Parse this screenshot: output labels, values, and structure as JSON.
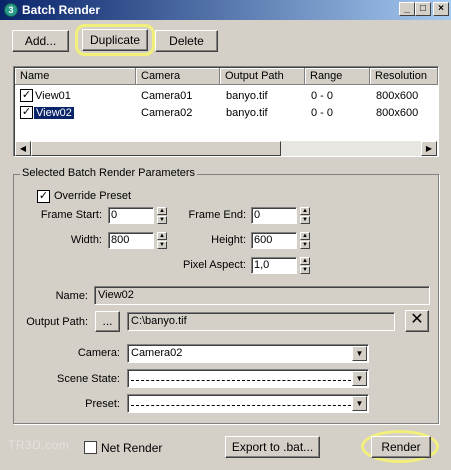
{
  "window": {
    "title": "Batch Render",
    "app_icon_glyph": "3"
  },
  "toolbar": {
    "add_label": "Add...",
    "duplicate_label": "Duplicate",
    "delete_label": "Delete"
  },
  "list": {
    "columns": [
      "Name",
      "Camera",
      "Output Path",
      "Range",
      "Resolution"
    ],
    "rows": [
      {
        "name": "View01",
        "camera": "Camera01",
        "output": "banyo.tif",
        "range": "0 - 0",
        "resolution": "800x600",
        "checked": true,
        "selected": false
      },
      {
        "name": "View02",
        "camera": "Camera02",
        "output": "banyo.tif",
        "range": "0 - 0",
        "resolution": "800x600",
        "checked": true,
        "selected": true
      }
    ]
  },
  "params": {
    "group_title": "Selected Batch Render Parameters",
    "override_label": "Override Preset",
    "override_checked": true,
    "frame_start_label": "Frame Start:",
    "frame_start": "0",
    "frame_end_label": "Frame End:",
    "frame_end": "0",
    "width_label": "Width:",
    "width": "800",
    "height_label": "Height:",
    "height": "600",
    "pixel_aspect_label": "Pixel Aspect:",
    "pixel_aspect": "1,0",
    "name_label": "Name:",
    "name": "View02",
    "output_path_label": "Output Path:",
    "browse_label": "...",
    "output_path": "C:\\banyo.tif",
    "camera_label": "Camera:",
    "camera": "Camera02",
    "scene_state_label": "Scene State:",
    "preset_label": "Preset:"
  },
  "footer": {
    "net_render_label": "Net Render",
    "export_label": "Export to .bat...",
    "render_label": "Render"
  },
  "watermark": "TR3D.com",
  "colors": {
    "titlebar_start": "#0a246a",
    "titlebar_end": "#a6caf0",
    "highlight": "#f2f07a",
    "selection": "#0a246a"
  }
}
